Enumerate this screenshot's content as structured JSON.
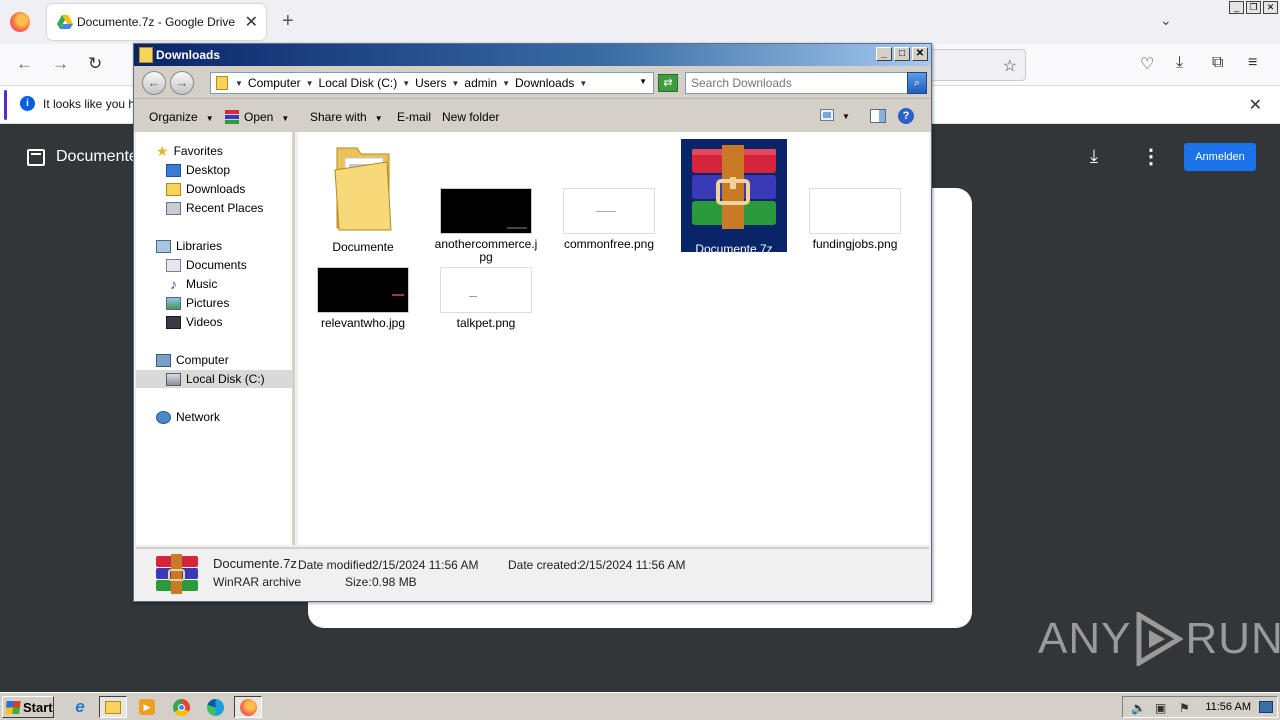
{
  "browser": {
    "tab_title": "Documente.7z - Google Drive",
    "notification_text": "It looks like you ha"
  },
  "drive": {
    "doc_title": "Documente",
    "signin_label": "Anmelden"
  },
  "explorer": {
    "title": "Downloads",
    "breadcrumbs": [
      "Computer",
      "Local Disk (C:)",
      "Users",
      "admin",
      "Downloads"
    ],
    "search_placeholder": "Search Downloads",
    "commands": {
      "organize": "Organize",
      "open": "Open",
      "share_with": "Share with",
      "email": "E-mail",
      "new_folder": "New folder"
    },
    "nav": {
      "favorites": "Favorites",
      "desktop": "Desktop",
      "downloads": "Downloads",
      "recent_places": "Recent Places",
      "libraries": "Libraries",
      "documents": "Documents",
      "music": "Music",
      "pictures": "Pictures",
      "videos": "Videos",
      "computer": "Computer",
      "local_disk": "Local Disk (C:)",
      "network": "Network"
    },
    "files": [
      {
        "name": "Documente",
        "kind": "folder"
      },
      {
        "name": "anothercommerce.jpg",
        "kind": "image-dark"
      },
      {
        "name": "commonfree.png",
        "kind": "image-light"
      },
      {
        "name": "Documente.7z",
        "kind": "winrar-archive",
        "selected": true
      },
      {
        "name": "fundingjobs.png",
        "kind": "image-light"
      },
      {
        "name": "relevantwho.jpg",
        "kind": "image-dark"
      },
      {
        "name": "talkpet.png",
        "kind": "image-light"
      }
    ],
    "details": {
      "name": "Documente.7z",
      "type": "WinRAR archive",
      "modified_label": "Date modified:",
      "modified_value": "2/15/2024 11:56 AM",
      "created_label": "Date created:",
      "created_value": "2/15/2024 11:56 AM",
      "size_label": "Size:",
      "size_value": "0.98 MB"
    }
  },
  "taskbar": {
    "start_label": "Start",
    "clock": "11:56 AM"
  },
  "watermark": {
    "left": "ANY",
    "right": "RUN"
  },
  "colors": {
    "drive_bg": "#323639",
    "signin_blue": "#1a73e8",
    "selection": "#0a246a",
    "title_gradient_start": "#0a246a"
  }
}
